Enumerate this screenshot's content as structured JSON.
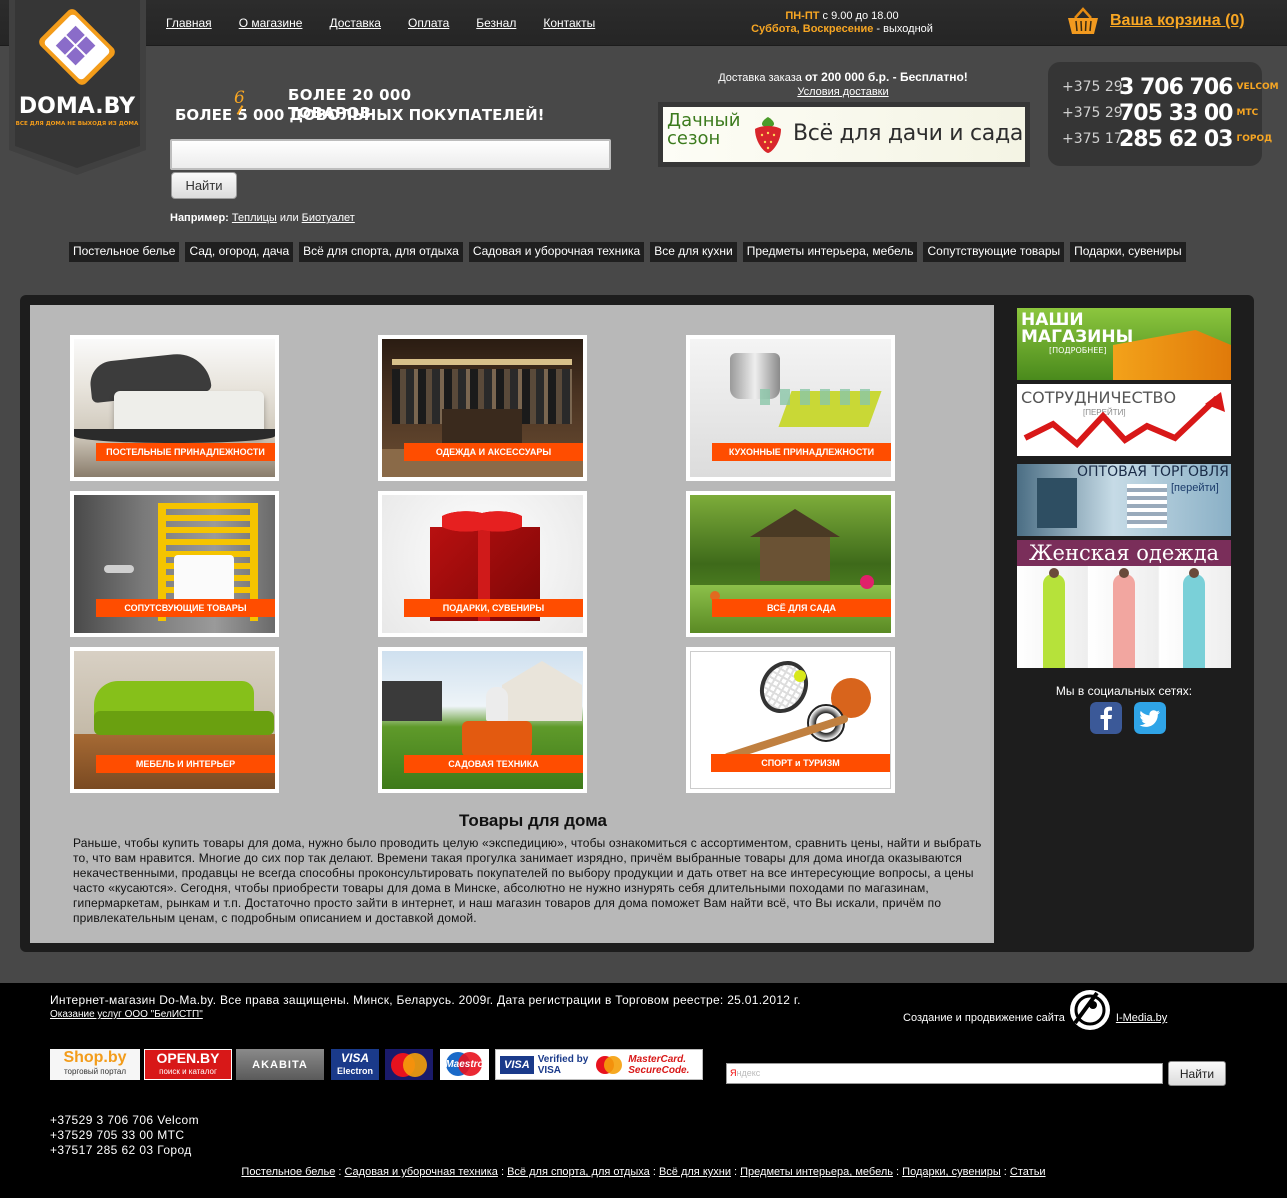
{
  "topnav": [
    "Главная",
    "О магазине",
    "Доставка",
    "Оплата",
    "Безнал",
    "Контакты"
  ],
  "hours": {
    "weekdays_label": "ПН-ПТ",
    "weekdays_time": " с 9.00 до 18.00",
    "weekend_label": "Суббота, Воскресение",
    "weekend_text": " - выходной"
  },
  "cart": {
    "label": "Ваша корзина (0)"
  },
  "logo": {
    "text": "DOMA.BY",
    "tagline": "ВСЕ ДЛЯ ДОМА НЕ ВЫХОДЯ ИЗ ДОМА"
  },
  "headline": {
    "line1": "БОЛЕЕ 20 000 ТОВАРОВ",
    "line2_prefix": "БОЛЕЕ ",
    "line2_struck": "5",
    "line2_new": "6",
    "line2_suffix": " 000 ДОВОЛЬНЫХ ПОКУПАТЕЛЕЙ!"
  },
  "search": {
    "value": "",
    "button": "Найти"
  },
  "example": {
    "label": "Например:",
    "link1": "Теплицы",
    "or": " или ",
    "link2": "Биотуалет"
  },
  "delivery": {
    "text": "Доставка заказа ",
    "bold": "от 200 000 б.р. - Бесплатно!",
    "link": "Условия доставки"
  },
  "dacha_banner": {
    "title": "Дачный сезон",
    "slogan": "Всё для дачи и сада"
  },
  "phones": [
    {
      "prefix": "+375 29",
      "number": "3 706 706",
      "operator": "VELCOM"
    },
    {
      "prefix": "+375 29",
      "number": "705 33 00",
      "operator": "МТС"
    },
    {
      "prefix": "+375 17",
      "number": "285 62 03",
      "operator": "ГОРОД"
    }
  ],
  "categories": [
    "Постельное белье",
    "Сад, огород, дача",
    "Всё для спорта, для отдыха",
    "Садовая и уборочная техника",
    "Все для кухни",
    "Предметы интерьера, мебель",
    "Сопутствующие товары",
    "Подарки, сувениры"
  ],
  "tiles": [
    {
      "label": "ПОСТЕЛЬНЫЕ ПРИНАДЛЕЖНОСТИ"
    },
    {
      "label": "ОДЕЖДА И АКСЕССУАРЫ"
    },
    {
      "label": "КУХОННЫЕ ПРИНАДЛЕЖНОСТИ"
    },
    {
      "label": "СОПУТСВУЮЩИЕ ТОВАРЫ"
    },
    {
      "label": "ПОДАРКИ, СУВЕНИРЫ"
    },
    {
      "label": "ВСЁ ДЛЯ САДА"
    },
    {
      "label": "МЕБЕЛЬ И ИНТЕРЬЕР"
    },
    {
      "label": "САДОВАЯ ТЕХНИКА"
    },
    {
      "label": "СПОРТ и ТУРИЗМ"
    }
  ],
  "section": {
    "title": "Товары для дома",
    "text": "Раньше, чтобы купить товары для дома, нужно было проводить целую «экспедицию», чтобы ознакомиться с ассортиментом, сравнить цены, найти и выбрать то, что вам нравится. Многие до сих пор так делают. Времени такая прогулка занимает изрядно, причём выбранные товары для дома иногда оказываются некачественными, продавцы не всегда способны проконсультировать покупателей по выбору продукции и дать ответ на все интересующие вопросы, а цены часто «кусаются». Сегодня, чтобы приобрести товары для дома в Минске, абсолютно не нужно изнурять себя длительными походами по магазинам, гипермаркетам, рынкам и т.п. Достаточно просто зайти в интернет, и наш магазин товаров для дома поможет Вам найти всё, что Вы искали, причём по привлекательным ценам, с подробным описанием и доставкой домой."
  },
  "side": {
    "stores": {
      "title1": "НАШИ",
      "title2": "МАГАЗИНЫ",
      "sub": "[ПОДРОБНЕЕ]"
    },
    "coop": {
      "title": "СОТРУДНИЧЕСТВО",
      "sub": "[ПЕРЕЙТИ]"
    },
    "wholesale": {
      "title": "ОПТОВАЯ ТОРГОВЛЯ",
      "sub": "[перейти]"
    },
    "women": {
      "title": "Женская одежда"
    },
    "social_label": "Мы в социальных сетях:"
  },
  "footer": {
    "copyright": "Интернет-магазин Do-Ma.by. Все права защищены. Минск, Беларусь. 2009г. Дата регистрации в Торговом реестре: 25.01.2012 г.",
    "service": "Оказание услуг ООО \"БелИСТП\"",
    "creation": "Создание и продвижение сайта",
    "imedia": "I-Media.by",
    "badges": {
      "shop": "Shop.by",
      "shop_sub": "торговый портал",
      "open": "OPEN.BY",
      "open_sub": "поиск и каталог",
      "akavita": "AKABITA",
      "visa_e1": "VISA",
      "visa_e2": "Electron",
      "mc_e": "MasterCard Electronic",
      "maestro": "Maestro",
      "vbv1": "Verified by",
      "vbv2": "VISA",
      "mcsc1": "MasterCard.",
      "mcsc2": "SecureCode."
    },
    "yandex_placeholder": "ндекс",
    "yandex_y": "Я",
    "yandex_button": "Найти",
    "phones": [
      "+37529 3 706 706 Velcom",
      "+37529 705 33 00 МТС",
      "+37517 285 62 03 Город"
    ],
    "links": [
      "Постельное белье",
      "Садовая и уборочная техника",
      "Всё для спорта, для отдыха",
      "Всё для кухни",
      "Предметы интерьера, мебель",
      "Подарки, сувениры",
      "Статьи"
    ]
  }
}
